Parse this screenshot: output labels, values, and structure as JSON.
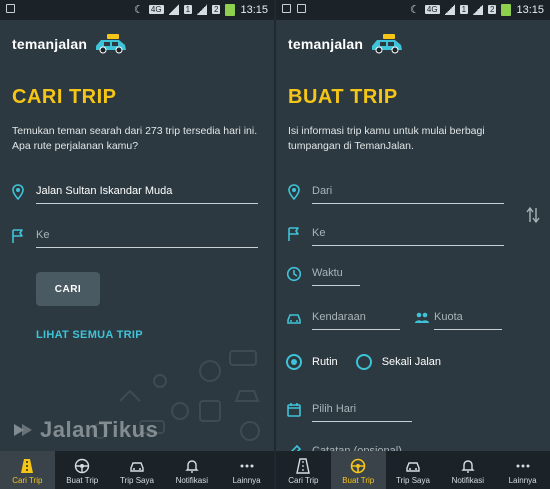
{
  "statusbar": {
    "network": "4G",
    "sim1": "1",
    "sim2": "2",
    "time": "13:15"
  },
  "brand": {
    "name": "temanjalan"
  },
  "left": {
    "title": "CARI TRIP",
    "description": "Temukan teman searah dari 273 trip tersedia hari ini. Apa rute perjalanan kamu?",
    "from_value": "Jalan Sultan Iskandar Muda",
    "to_placeholder": "Ke",
    "search_button": "CARI",
    "all_trips_link": "LIHAT SEMUA TRIP"
  },
  "right": {
    "title": "BUAT TRIP",
    "description": "Isi informasi trip kamu untuk mulai berbagi tumpangan di TemanJalan.",
    "from_placeholder": "Dari",
    "to_placeholder": "Ke",
    "time_placeholder": "Waktu",
    "vehicle_placeholder": "Kendaraan",
    "quota_placeholder": "Kuota",
    "radio_routine": "Rutin",
    "radio_once": "Sekali Jalan",
    "day_placeholder": "Pilih Hari",
    "note_placeholder": "Catatan (opsional)"
  },
  "watermark": "JalanTikus",
  "nav": [
    "Cari Trip",
    "Buat Trip",
    "Trip Saya",
    "Notifikasi",
    "Lainnya"
  ],
  "colors": {
    "accent_yellow": "#f5c518",
    "accent_cyan": "#3fc3d8",
    "background": "#2c3940"
  }
}
